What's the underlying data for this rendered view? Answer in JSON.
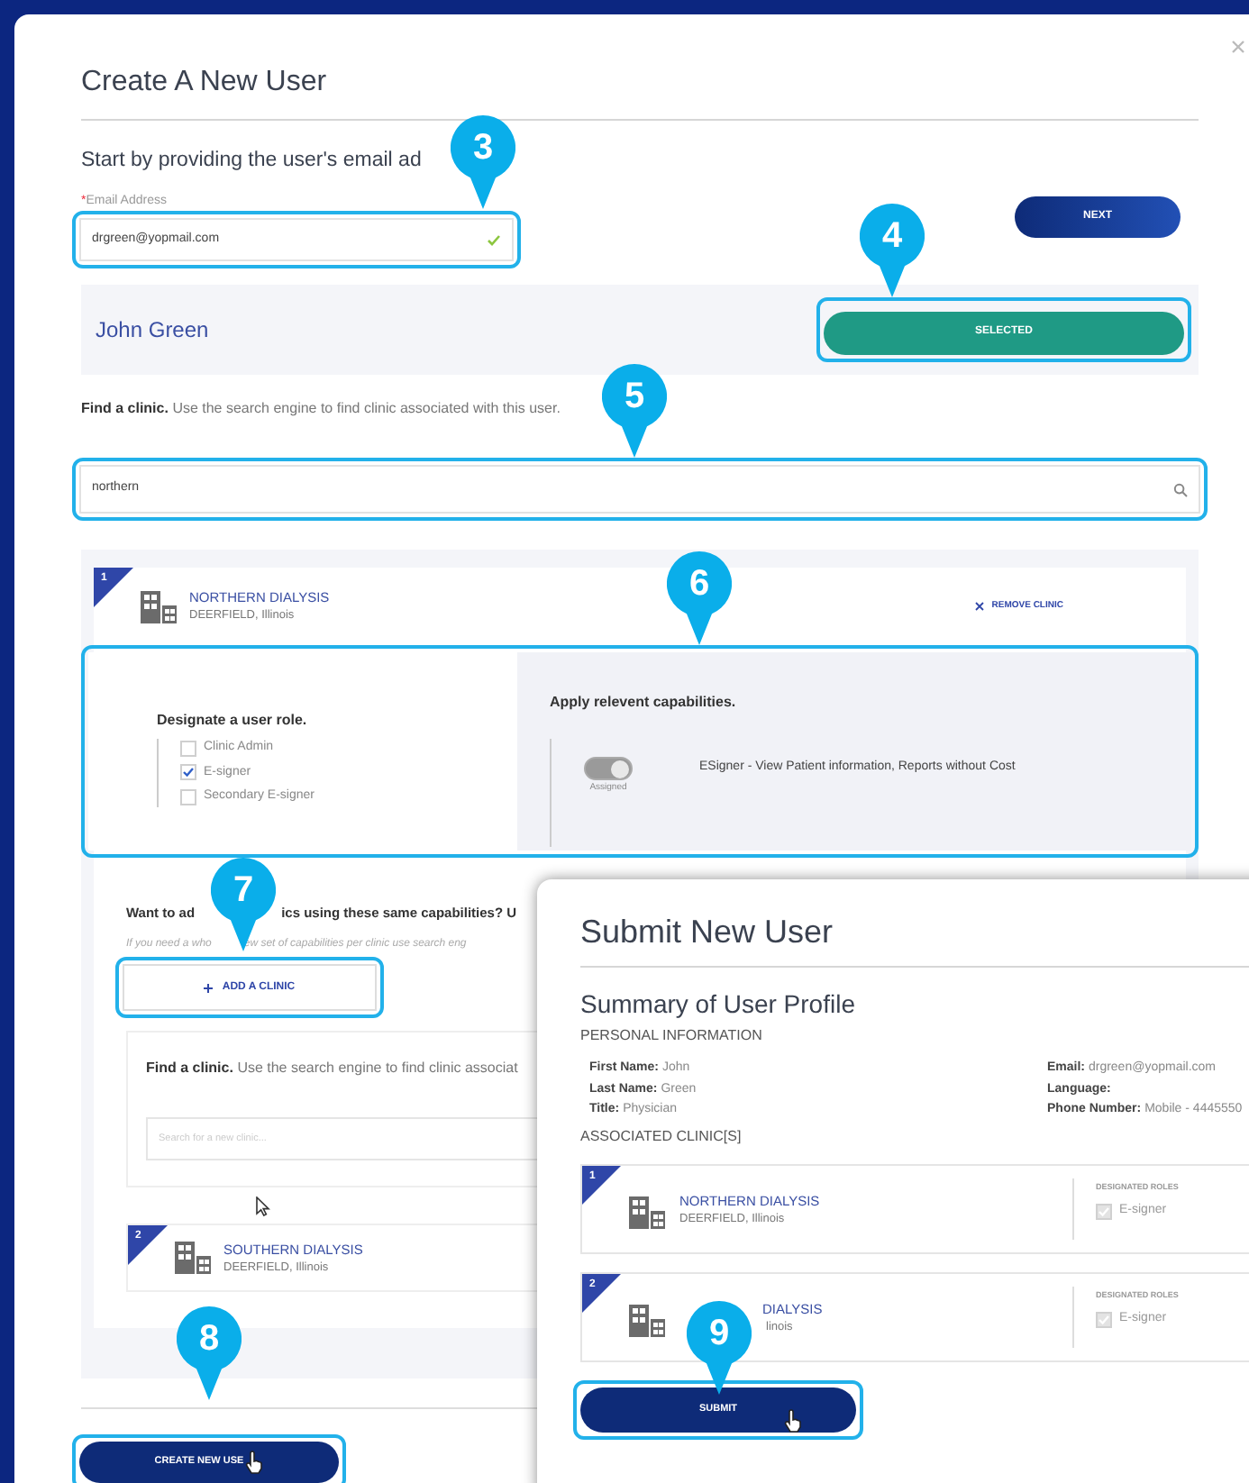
{
  "main_dialog": {
    "title": "Create A New User",
    "email_step": {
      "prompt": "Start by providing the user's email ad",
      "required_mark": "*",
      "field_label": "Email Address",
      "email": "drgreen@yopmail.com",
      "valid": true,
      "next": "NEXT"
    },
    "user_match": {
      "name": "John Green",
      "button": "SELECTED",
      "selected": true
    },
    "clinic_search": {
      "heading": "Find a clinic.",
      "hint": "Use the search engine to find clinic associated with this user.",
      "value": "northern"
    },
    "clinic": {
      "number": "1",
      "name": "NORTHERN DIALYSIS",
      "location": "DEERFIELD, Illinois",
      "remove": "REMOVE CLINIC",
      "roles_title": "Designate a user role.",
      "roles": [
        {
          "label": "Clinic Admin",
          "checked": false
        },
        {
          "label": "E-signer",
          "checked": true
        },
        {
          "label": "Secondary E-signer",
          "checked": false
        }
      ],
      "capabilities_title": "Apply relevent capabilities.",
      "capabilities": [
        {
          "status": "Assigned",
          "on": true,
          "label": "ESigner - View Patient information, Reports without Cost"
        }
      ]
    },
    "add_more": {
      "question_start": "Want to ad",
      "question_end": "ics using these same capabilities? U",
      "hint_start": "If you need a who",
      "hint_end": "ew set of capabilities per clinic use search eng",
      "button": "ADD A CLINIC"
    },
    "new_search": {
      "heading": "Find a clinic.",
      "hint": "Use the search engine to find clinic associat",
      "placeholder": "Search for a new clinic..."
    },
    "second_clinic": {
      "number": "2",
      "name": "SOUTHERN DIALYSIS",
      "location": "DEERFIELD, Illinois"
    },
    "create_button": "CREATE NEW USE"
  },
  "summary_dialog": {
    "title": "Submit New User",
    "subtitle": "Summary of User Profile",
    "personal_heading": "PERSONAL INFORMATION",
    "fields_left": [
      {
        "label": "First Name:",
        "value": "John"
      },
      {
        "label": "Last Name:",
        "value": "Green"
      },
      {
        "label": "Title:",
        "value": "Physician"
      }
    ],
    "fields_right": [
      {
        "label": "Email:",
        "value": "drgreen@yopmail.com"
      },
      {
        "label": "Language:"
      },
      {
        "label": "Phone Number:",
        "value": "Mobile - 4445550"
      }
    ],
    "clinics_heading": "ASSOCIATED CLINIC[S]",
    "clinics": [
      {
        "number": "1",
        "name": "NORTHERN DIALYSIS",
        "location": "DEERFIELD, Illinois",
        "covered": false,
        "roles_heading": "DESIGNATED ROLES",
        "roles": [
          {
            "label": "E-signer",
            "checked": true
          }
        ]
      },
      {
        "number": "2",
        "name": "DIALYSIS",
        "location": "linois",
        "covered": true,
        "roles_heading": "DESIGNATED ROLES",
        "roles": [
          {
            "label": "E-signer",
            "checked": true
          }
        ]
      }
    ],
    "submit": "SUBMIT"
  },
  "callouts": [
    {
      "number": "3"
    },
    {
      "number": "4"
    },
    {
      "number": "5"
    },
    {
      "number": "6"
    },
    {
      "number": "7"
    },
    {
      "number": "8"
    },
    {
      "number": "9"
    }
  ]
}
